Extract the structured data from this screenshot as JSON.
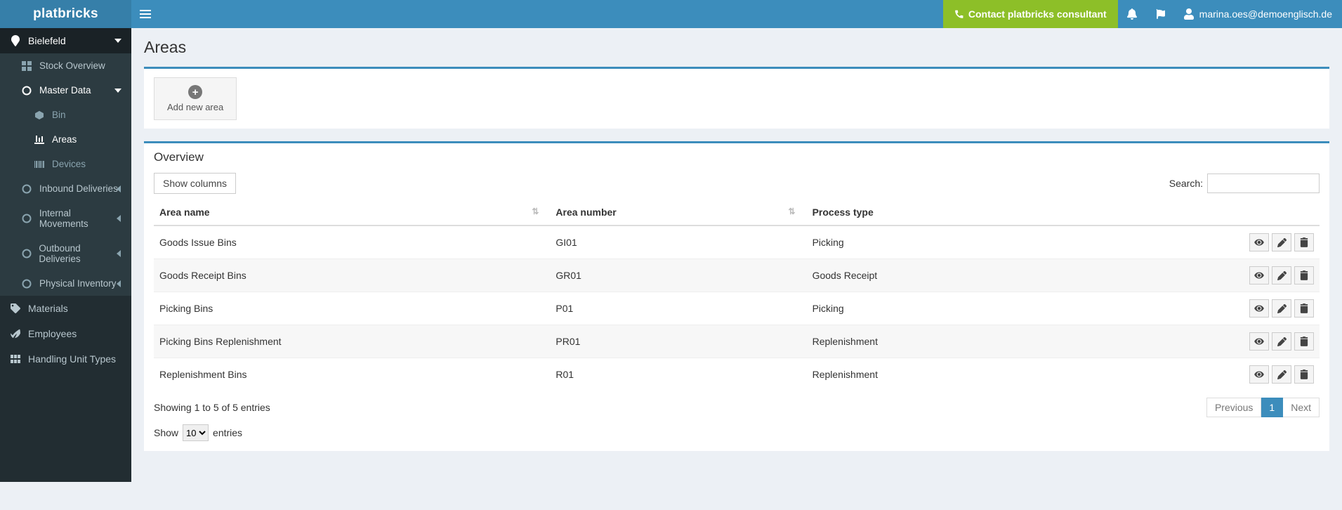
{
  "brand": "platbricks",
  "topbar": {
    "contact_label": "Contact platbricks consultant",
    "user_label": "marina.oes@demoenglisch.de"
  },
  "sidebar": {
    "site": "Bielefeld",
    "stock_overview": "Stock Overview",
    "master_data": "Master Data",
    "master_data_children": {
      "bin": "Bin",
      "areas": "Areas",
      "devices": "Devices"
    },
    "inbound": "Inbound Deliveries",
    "internal": "Internal Movements",
    "outbound": "Outbound Deliveries",
    "physical": "Physical Inventory",
    "materials": "Materials",
    "employees": "Employees",
    "hut": "Handling Unit Types"
  },
  "page": {
    "title": "Areas",
    "add_label": "Add new area"
  },
  "overview": {
    "title": "Overview",
    "show_columns": "Show columns",
    "search_label": "Search:",
    "search_value": "",
    "columns": {
      "name": "Area name",
      "number": "Area number",
      "ptype": "Process type"
    },
    "rows": [
      {
        "name": "Goods Issue Bins",
        "number": "GI01",
        "ptype": "Picking"
      },
      {
        "name": "Goods Receipt Bins",
        "number": "GR01",
        "ptype": "Goods Receipt"
      },
      {
        "name": "Picking Bins",
        "number": "P01",
        "ptype": "Picking"
      },
      {
        "name": "Picking Bins Replenishment",
        "number": "PR01",
        "ptype": "Replenishment"
      },
      {
        "name": "Replenishment Bins",
        "number": "R01",
        "ptype": "Replenishment"
      }
    ],
    "info": "Showing 1 to 5 of 5 entries",
    "pager": {
      "prev": "Previous",
      "page1": "1",
      "next": "Next"
    },
    "length": {
      "prefix": "Show",
      "value": "10",
      "suffix": "entries"
    }
  }
}
